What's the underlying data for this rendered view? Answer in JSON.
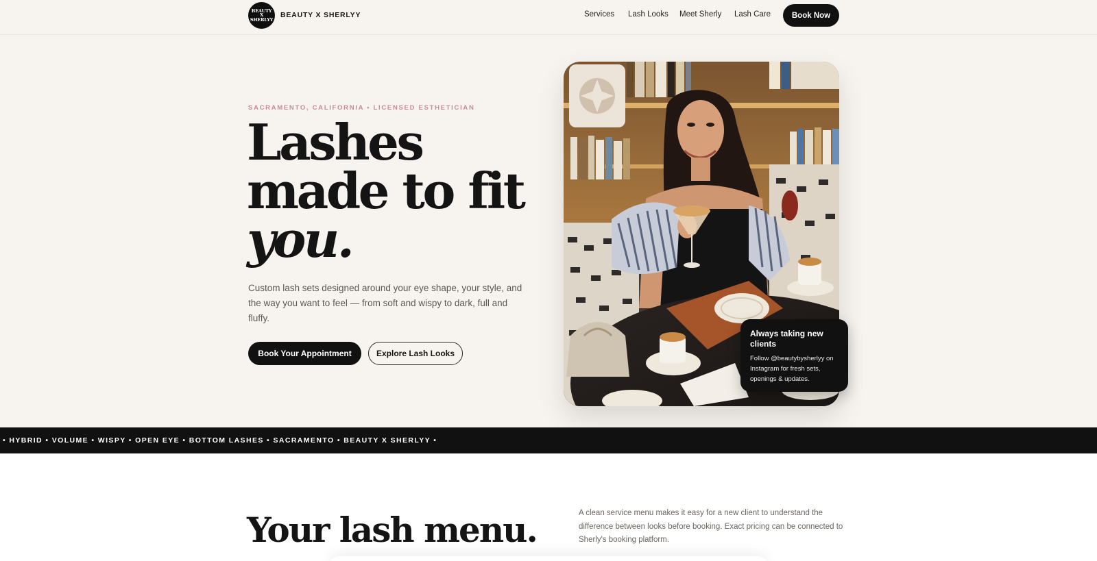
{
  "brand": {
    "logo_lines": [
      "BEAUTY",
      "X",
      "SHERLYY"
    ],
    "name": "BEAUTY X SHERLYY"
  },
  "nav": {
    "links": [
      "Services",
      "Lash Looks",
      "Meet Sherly",
      "Lash Care"
    ],
    "book_label": "Book Now"
  },
  "hero": {
    "eyebrow": "SACRAMENTO, CALIFORNIA • LICENSED ESTHETICIAN",
    "headline_line1": "Lashes",
    "headline_line2": "made to fit",
    "headline_line3": "you.",
    "subtext": "Custom lash sets designed around your eye shape, your style, and the way you want to feel — from soft and wispy to dark, full and fluffy.",
    "cta_primary": "Book Your Appointment",
    "cta_secondary": "Explore Lash Looks"
  },
  "badge": {
    "title": "Always taking new clients",
    "body": "Follow @beautybysherlyy on Instagram for fresh sets, openings & updates."
  },
  "marquee": {
    "text": "• HYBRID • VOLUME • WISPY • OPEN EYE • BOTTOM LASHES • SACRAMENTO • BEAUTY X SHERLYY •"
  },
  "menu_section": {
    "title": "Your lash menu.",
    "description": "A clean service menu makes it easy for a new client to understand the difference between looks before booking. Exact pricing can be connected to Sherly's booking platform."
  },
  "colors": {
    "background": "#f7f3ef",
    "accent_pink": "#c98b96",
    "dark": "#111111"
  }
}
